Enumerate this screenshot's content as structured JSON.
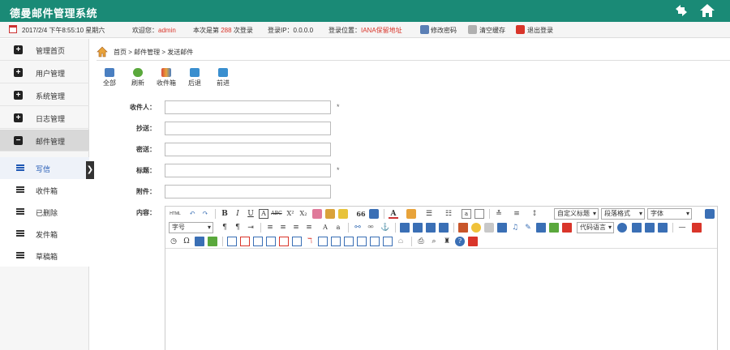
{
  "app": {
    "title": "德曼邮件管理系统"
  },
  "info": {
    "datetime": "2017/2/4 下午8:55:10 星期六",
    "welcome_prefix": "欢迎您：",
    "username": "admin",
    "login_count_prefix": "本次是第",
    "login_count": "288",
    "login_count_suffix": "次登录",
    "ip": "登录IP：0.0.0.0",
    "location_prefix": "登录位置：",
    "location": "IANA保留地址",
    "change_password": "修改密码",
    "clear_cache": "清空缓存",
    "logout": "退出登录"
  },
  "sidebar": {
    "items": [
      {
        "label": "管理首页",
        "icon": "plus-icon"
      },
      {
        "label": "用户管理",
        "icon": "plus-icon"
      },
      {
        "label": "系统管理",
        "icon": "plus-icon"
      },
      {
        "label": "日志管理",
        "icon": "plus-icon"
      },
      {
        "label": "邮件管理",
        "icon": "minus-icon"
      }
    ],
    "subitems": [
      {
        "label": "写信"
      },
      {
        "label": "收件箱"
      },
      {
        "label": "已删除"
      },
      {
        "label": "发件箱"
      },
      {
        "label": "草稿箱"
      }
    ],
    "collapse_glyph": "❯"
  },
  "breadcrumb": {
    "text": "首页 > 邮件管理 > 发送邮件"
  },
  "toolbar": {
    "all": "全部",
    "refresh": "刷新",
    "inbox": "收件箱",
    "back": "后退",
    "forward": "前进"
  },
  "form": {
    "to_label": "收件人：",
    "cc_label": "抄送：",
    "bcc_label": "密送：",
    "subject_label": "标题：",
    "attachment_label": "附件：",
    "content_label": "内容：",
    "required_mark": "*",
    "to_value": "",
    "cc_value": "",
    "bcc_value": "",
    "subject_value": "",
    "attachment_value": ""
  },
  "editor": {
    "custom_title": "自定义标题",
    "paragraph_format": "段落格式",
    "font_family": "字体",
    "font_size": "字号",
    "code_language": "代码语言",
    "glyphs": {
      "bold": "B",
      "italic": "I",
      "underline": "U",
      "strike": "ABC",
      "superscript": "X²",
      "subscript": "X₂",
      "quote": "66",
      "font_color": "A",
      "html": "HTML"
    }
  },
  "colors": {
    "header_bg": "#1a8a76",
    "accent_red": "#d9352a",
    "link_blue": "#1e57b4"
  }
}
